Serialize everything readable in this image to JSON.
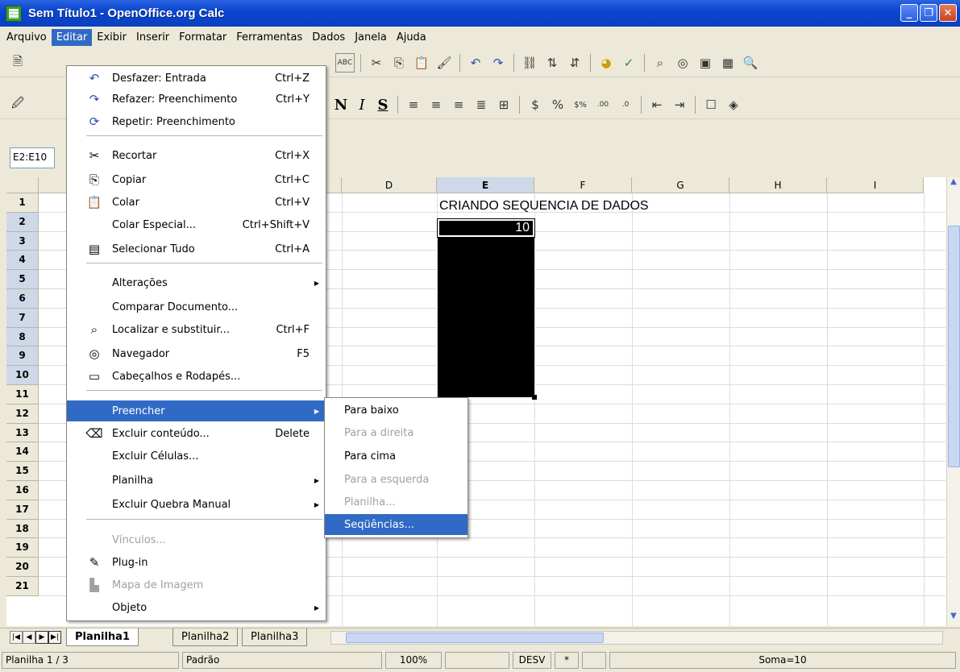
{
  "window": {
    "title": "Sem Título1 - OpenOffice.org Calc"
  },
  "menubar": [
    "Arquivo",
    "Editar",
    "Exibir",
    "Inserir",
    "Formatar",
    "Ferramentas",
    "Dados",
    "Janela",
    "Ajuda"
  ],
  "namebox": "E2:E10",
  "columns": [
    "D",
    "E",
    "F",
    "G",
    "H",
    "I"
  ],
  "rows": [
    "1",
    "2",
    "3",
    "4",
    "5",
    "6",
    "7",
    "8",
    "9",
    "10",
    "11",
    "12",
    "13",
    "14",
    "15",
    "16",
    "17",
    "18",
    "19",
    "20",
    "21"
  ],
  "cells": {
    "E1": "CRIANDO SEQUENCIA DE DADOS",
    "E2": "10"
  },
  "edit_menu": [
    {
      "label": "Desfazer: Entrada",
      "shortcut": "Ctrl+Z",
      "icon": "undo-icon"
    },
    {
      "label": "Refazer: Preenchimento",
      "shortcut": "Ctrl+Y",
      "icon": "redo-icon"
    },
    {
      "label": "Repetir: Preenchimento",
      "shortcut": "",
      "icon": "repeat-icon"
    },
    {
      "label": "Recortar",
      "shortcut": "Ctrl+X",
      "icon": "cut-icon"
    },
    {
      "label": "Copiar",
      "shortcut": "Ctrl+C",
      "icon": "copy-icon"
    },
    {
      "label": "Colar",
      "shortcut": "Ctrl+V",
      "icon": "paste-icon"
    },
    {
      "label": "Colar Especial...",
      "shortcut": "Ctrl+Shift+V",
      "icon": ""
    },
    {
      "label": "Selecionar Tudo",
      "shortcut": "Ctrl+A",
      "icon": "select-all-icon"
    },
    {
      "label": "Alterações",
      "shortcut": "",
      "icon": ""
    },
    {
      "label": "Comparar Documento...",
      "shortcut": "",
      "icon": ""
    },
    {
      "label": "Localizar e substituir...",
      "shortcut": "Ctrl+F",
      "icon": "binoculars-icon"
    },
    {
      "label": "Navegador",
      "shortcut": "F5",
      "icon": "navigator-icon"
    },
    {
      "label": "Cabeçalhos e Rodapés...",
      "shortcut": "",
      "icon": "header-footer-icon"
    },
    {
      "label": "Preencher",
      "shortcut": "",
      "icon": ""
    },
    {
      "label": "Excluir conteúdo...",
      "shortcut": "Delete",
      "icon": "delete-contents-icon"
    },
    {
      "label": "Excluir Células...",
      "shortcut": "",
      "icon": ""
    },
    {
      "label": "Planilha",
      "shortcut": "",
      "icon": ""
    },
    {
      "label": "Excluir Quebra Manual",
      "shortcut": "",
      "icon": ""
    },
    {
      "label": "Vínculos...",
      "shortcut": "",
      "icon": ""
    },
    {
      "label": "Plug-in",
      "shortcut": "",
      "icon": "plugin-icon"
    },
    {
      "label": "Mapa de Imagem",
      "shortcut": "",
      "icon": "image-map-icon"
    },
    {
      "label": "Objeto",
      "shortcut": "",
      "icon": ""
    }
  ],
  "fill_submenu": [
    "Para baixo",
    "Para a direita",
    "Para cima",
    "Para a esquerda",
    "Planilha...",
    "Seqüências..."
  ],
  "sheets": [
    "Planilha1",
    "Planilha2",
    "Planilha3"
  ],
  "status": {
    "page": "Planilha 1 / 3",
    "style": "Padrão",
    "zoom": "100%",
    "mode": "DESV",
    "modified": "*",
    "sum": "Soma=10"
  }
}
